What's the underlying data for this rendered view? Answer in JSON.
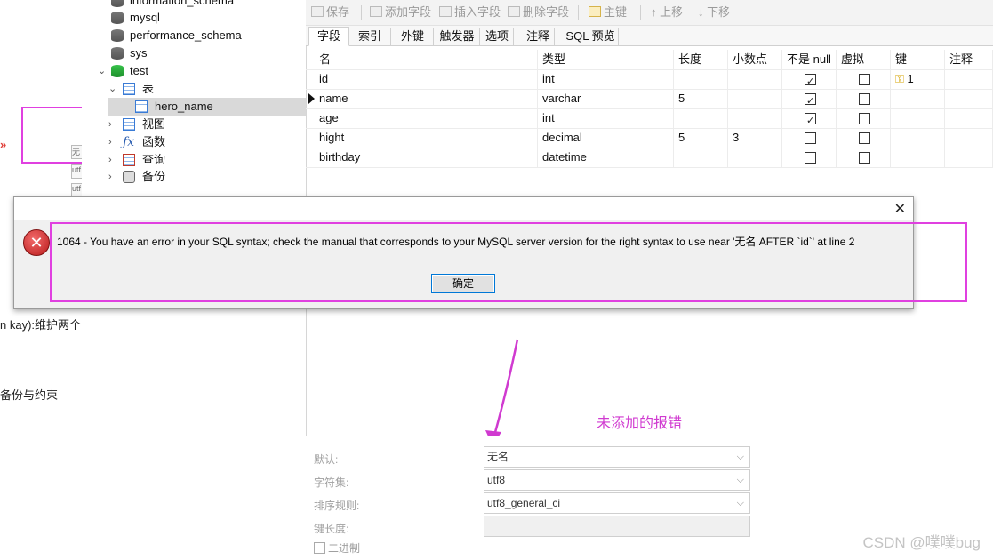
{
  "blog": {
    "cells": [
      "无",
      "utf",
      "utf"
    ],
    "line1": "n kay):维护两个",
    "line2": "备份与约束"
  },
  "tree": {
    "items": [
      {
        "label": "information_schema",
        "kind": "db"
      },
      {
        "label": "mysql",
        "kind": "db"
      },
      {
        "label": "performance_schema",
        "kind": "db"
      },
      {
        "label": "sys",
        "kind": "db"
      },
      {
        "label": "test",
        "kind": "db-open"
      },
      {
        "label": "表",
        "kind": "folder"
      },
      {
        "label": "hero_name",
        "kind": "table",
        "selected": true
      },
      {
        "label": "视图",
        "kind": "group"
      },
      {
        "label": "函数",
        "kind": "group"
      },
      {
        "label": "查询",
        "kind": "group"
      },
      {
        "label": "备份",
        "kind": "group"
      }
    ]
  },
  "toolbar": {
    "save": "保存",
    "add_field": "添加字段",
    "insert_field": "插入字段",
    "delete_field": "删除字段",
    "primary_key": "主键",
    "move_up": "上移",
    "move_down": "下移"
  },
  "tabs": [
    "字段",
    "索引",
    "外键",
    "触发器",
    "选项",
    "注释",
    "SQL 预览"
  ],
  "grid": {
    "headers": [
      "名",
      "类型",
      "长度",
      "小数点",
      "不是 null",
      "虚拟",
      "键",
      "注释"
    ],
    "rows": [
      {
        "name": "id",
        "type": "int",
        "length": "",
        "decimals": "",
        "not_null": true,
        "virtual": false,
        "key": "1"
      },
      {
        "name": "name",
        "type": "varchar",
        "length": "5",
        "decimals": "",
        "not_null": true,
        "virtual": false,
        "key": "",
        "current": true
      },
      {
        "name": "age",
        "type": "int",
        "length": "",
        "decimals": "",
        "not_null": true,
        "virtual": false,
        "key": ""
      },
      {
        "name": "hight",
        "type": "decimal",
        "length": "5",
        "decimals": "3",
        "not_null": false,
        "virtual": false,
        "key": ""
      },
      {
        "name": "birthday",
        "type": "datetime",
        "length": "",
        "decimals": "",
        "not_null": false,
        "virtual": false,
        "key": ""
      }
    ]
  },
  "props": {
    "default_label": "默认:",
    "default_value": "无名",
    "charset_label": "字符集:",
    "charset_value": "utf8",
    "collation_label": "排序规则:",
    "collation_value": "utf8_general_ci",
    "key_length_label": "键长度:",
    "key_length_value": "",
    "binary_label": "二进制"
  },
  "annotation": "未添加的报错",
  "dialog": {
    "message": "1064 - You have an error in your SQL syntax; check the manual that corresponds to your MySQL server version for the right syntax to use near '无名 AFTER `id`' at line 2",
    "ok_label": "确定",
    "close_glyph": "✕"
  },
  "watermark": "CSDN @噗噗bug",
  "colors": {
    "annotation": "#d03ad0",
    "error": "#c62828",
    "selection": "#d9d9d9"
  }
}
